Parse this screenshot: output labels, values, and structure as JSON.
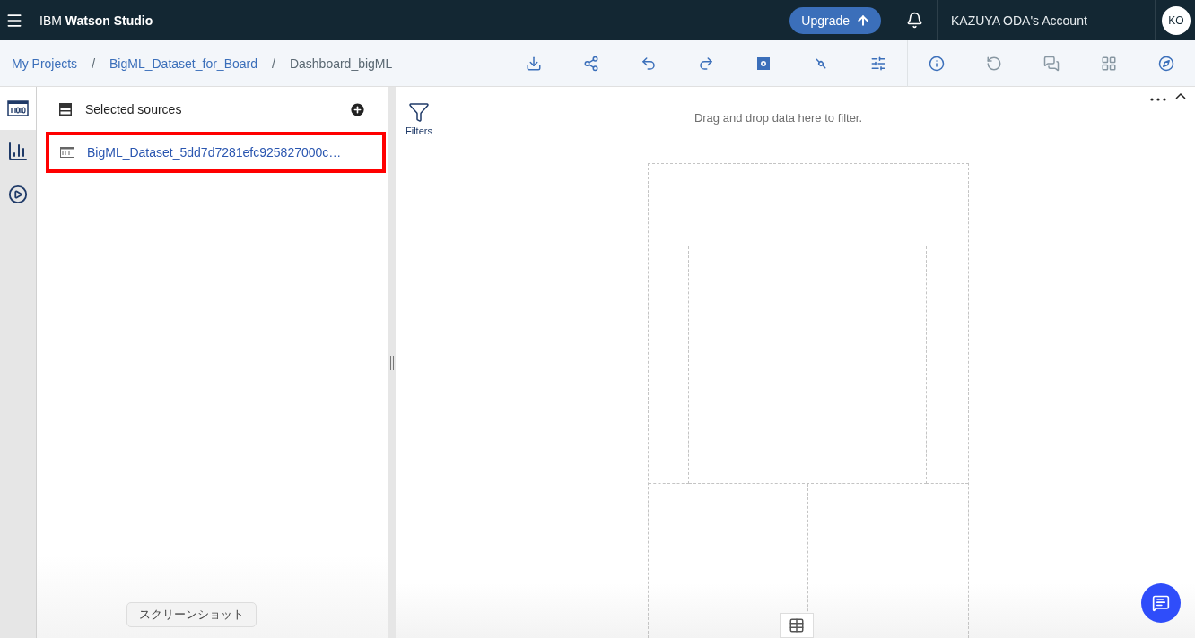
{
  "topbar": {
    "brand_prefix": "IBM",
    "brand_name": "Watson Studio",
    "upgrade": "Upgrade",
    "account": "KAZUYA ODA's Account",
    "avatar": "KO"
  },
  "breadcrumbs": [
    {
      "label": "My Projects",
      "link": true
    },
    {
      "label": "BigML_Dataset_for_Board",
      "link": true
    },
    {
      "label": "Dashboard_bigML",
      "link": false
    }
  ],
  "breadcrumb_separator": "/",
  "toolbar": [
    {
      "kind": "download",
      "disabled": false
    },
    {
      "kind": "share",
      "disabled": false
    },
    {
      "kind": "undo",
      "disabled": false
    },
    {
      "kind": "redo",
      "disabled": false
    },
    {
      "kind": "save",
      "disabled": false
    },
    {
      "kind": "connect",
      "disabled": false
    },
    {
      "kind": "sliders",
      "disabled": false
    },
    {
      "kind": "separator"
    },
    {
      "kind": "info",
      "disabled": false
    },
    {
      "kind": "search-back",
      "disabled": true
    },
    {
      "kind": "chat-bubbles",
      "disabled": true
    },
    {
      "kind": "grid",
      "disabled": true
    },
    {
      "kind": "compass",
      "disabled": false
    }
  ],
  "rail": [
    {
      "kind": "data",
      "selected": true
    },
    {
      "kind": "chart",
      "selected": false
    },
    {
      "kind": "text-play",
      "selected": false
    }
  ],
  "sources": {
    "title": "Selected sources",
    "items": [
      {
        "name": "BigML_Dataset_5dd7d7281efc925827000c…",
        "highlighted": true
      }
    ]
  },
  "filters": {
    "label": "Filters",
    "hint": "Drag and drop data here to filter."
  },
  "tooltip": "スクリーンショット"
}
